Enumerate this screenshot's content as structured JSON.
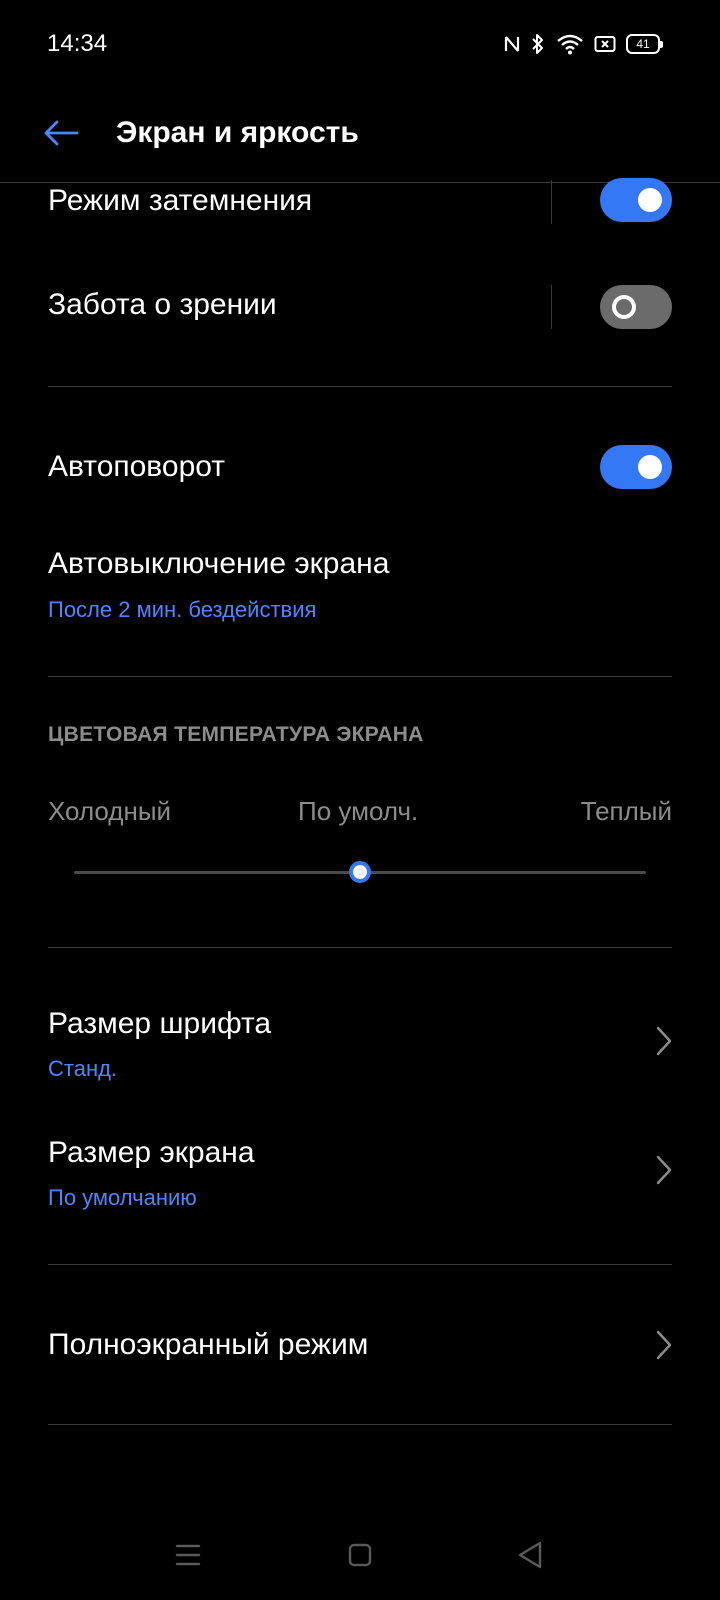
{
  "status_bar": {
    "time": "14:34",
    "battery_level": "41",
    "icons": [
      "nfc-icon",
      "bluetooth-icon",
      "wifi-icon",
      "sim-blocked-icon",
      "battery-icon"
    ]
  },
  "header": {
    "title": "Экран и яркость",
    "back_icon": "arrow-left-icon"
  },
  "settings": {
    "dark_mode": {
      "label": "Режим затемнения",
      "enabled": true
    },
    "eye_care": {
      "label": "Забота о зрении",
      "enabled": false
    },
    "auto_rotate": {
      "label": "Автоповорот",
      "enabled": true
    },
    "screen_timeout": {
      "label": "Автовыключение экрана",
      "value": "После 2 мин. бездействия"
    },
    "color_temperature": {
      "section_title": "ЦВЕТОВАЯ ТЕМПЕРАТУРА ЭКРАНА",
      "cold_label": "Холодный",
      "default_label": "По умолч.",
      "warm_label": "Теплый",
      "slider_value": 0.5
    },
    "font_size": {
      "label": "Размер шрифта",
      "value": "Станд."
    },
    "display_size": {
      "label": "Размер экрана",
      "value": "По умолчанию"
    },
    "fullscreen": {
      "label": "Полноэкранный режим"
    }
  },
  "nav_bar": {
    "icons": [
      "menu-icon",
      "home-icon",
      "back-triangle-icon"
    ]
  },
  "colors": {
    "accent": "#3478f6",
    "subtext": "#4a87ff",
    "toggle_off": "#6b6b6b",
    "section_title": "#8c8c8c",
    "divider": "#3a3a3a"
  }
}
